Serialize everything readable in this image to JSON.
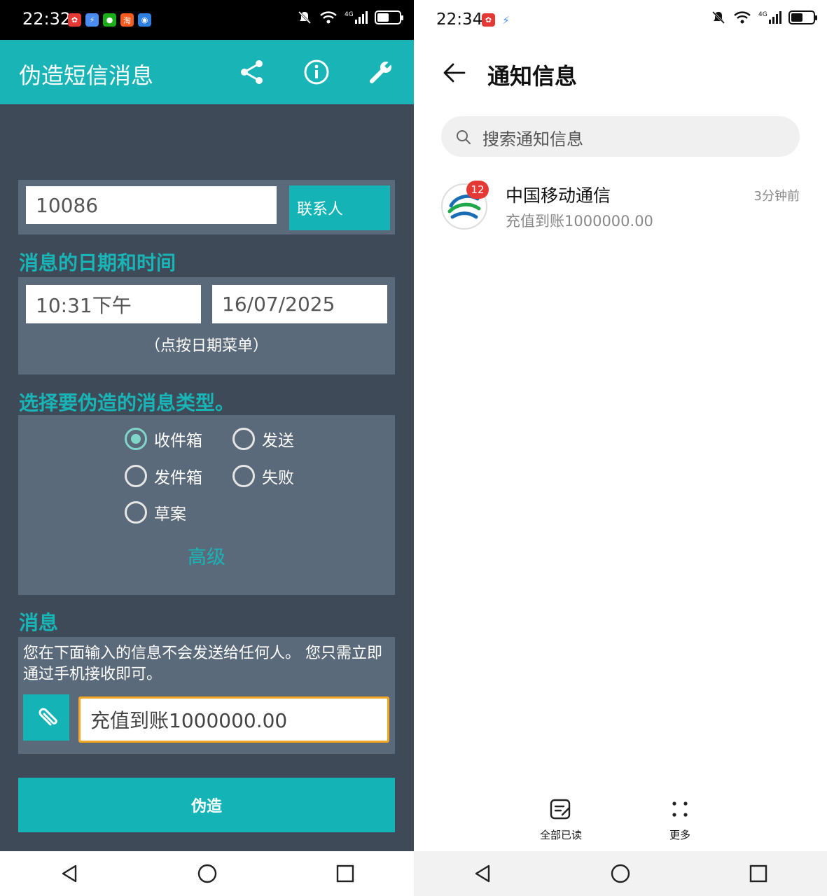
{
  "left": {
    "status": {
      "time": "22:32",
      "network": "4G"
    },
    "appbar": {
      "title": "伪造短信消息"
    },
    "contact": {
      "number": "10086",
      "button_label": "联系人"
    },
    "datetime": {
      "section_label": "消息的日期和时间",
      "time_value": "10:31下午",
      "date_value": "16/07/2025",
      "hint": "（点按日期菜单）"
    },
    "msg_type": {
      "section_label": "选择要伪造的消息类型。",
      "options": [
        {
          "label": "收件箱",
          "selected": true
        },
        {
          "label": "发送",
          "selected": false
        },
        {
          "label": "发件箱",
          "selected": false
        },
        {
          "label": "失败",
          "selected": false
        },
        {
          "label": "草案",
          "selected": false
        }
      ],
      "advanced_label": "高级"
    },
    "message": {
      "section_label": "消息",
      "notice": "您在下面输入的信息不会发送给任何人。 您只需立即通过手机接收即可。",
      "content": "充值到账1000000.00"
    },
    "submit_label": "伪造"
  },
  "right": {
    "status": {
      "time": "22:34",
      "network": "4G"
    },
    "header": {
      "title": "通知信息"
    },
    "search": {
      "placeholder": "搜索通知信息"
    },
    "messages": [
      {
        "sender": "中国移动通信",
        "preview": "充值到账1000000.00",
        "time": "3分钟前",
        "badge": "12"
      }
    ],
    "bottom": {
      "mark_all_read": "全部已读",
      "more": "更多"
    }
  },
  "colors": {
    "teal": "#19b4b6",
    "panel": "#5b6a7a",
    "background": "#3e4a57",
    "badge": "#e53935"
  }
}
